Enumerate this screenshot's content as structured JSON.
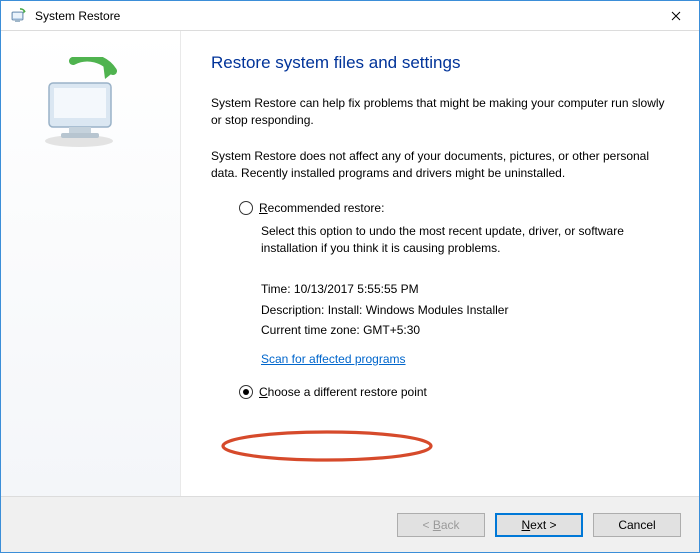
{
  "window": {
    "title": "System Restore"
  },
  "heading": "Restore system files and settings",
  "intro1": "System Restore can help fix problems that might be making your computer run slowly or stop responding.",
  "intro2": "System Restore does not affect any of your documents, pictures, or other personal data. Recently installed programs and drivers might be uninstalled.",
  "recommended": {
    "label_prefix": "R",
    "label_rest": "ecommended restore:",
    "desc": "Select this option to undo the most recent update, driver, or software installation if you think it is causing problems.",
    "time_label": "Time:",
    "time_value": "10/13/2017 5:55:55 PM",
    "desc_label": "Description:",
    "desc_value": "Install: Windows Modules Installer",
    "tz_label": "Current time zone:",
    "tz_value": "GMT+5:30",
    "scan_link": "Scan for affected programs"
  },
  "choose": {
    "label_prefix": "C",
    "label_rest": "hoose a different restore point"
  },
  "buttons": {
    "back_pre": "< ",
    "back_u": "B",
    "back_post": "ack",
    "next_u": "N",
    "next_post": "ext >",
    "cancel": "Cancel"
  }
}
